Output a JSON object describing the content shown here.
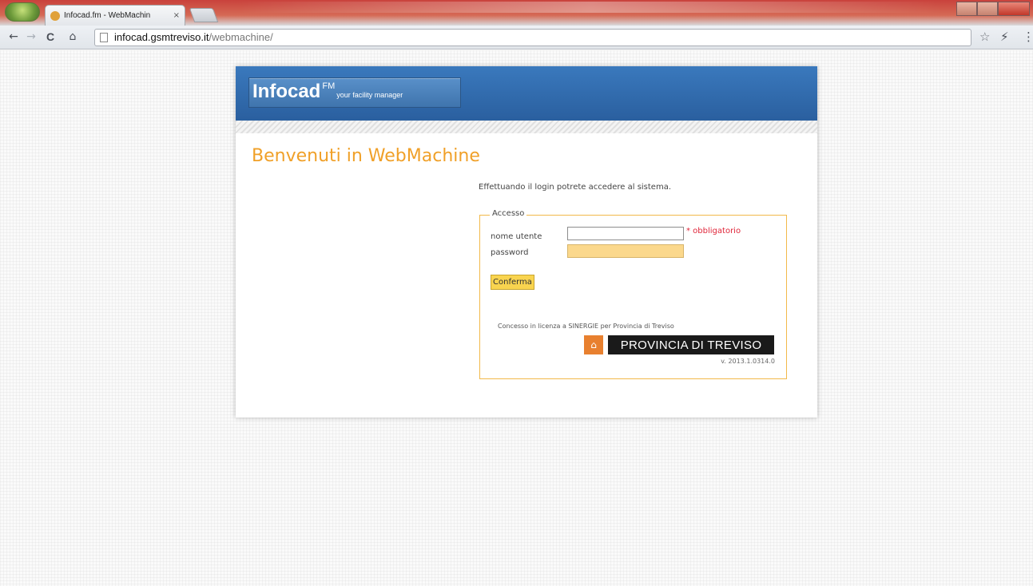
{
  "browser": {
    "tab_title": "Infocad.fm - WebMachin",
    "tab_close": "×",
    "url_host": "infocad.gsmtreviso.it",
    "url_path": "/webmachine/",
    "back": "←",
    "forward": "→",
    "reload": "C",
    "home": "⌂",
    "star": "☆",
    "menu": "⚡"
  },
  "header": {
    "logo_main": "Infocad",
    "logo_sup": "FM",
    "logo_tagline": "your facility manager"
  },
  "main": {
    "title": "Benvenuti in WebMachine",
    "intro": "Effettuando il login potrete accedere al sistema."
  },
  "login": {
    "legend": "Accesso",
    "username_label": "nome utente",
    "password_label": "password",
    "username_value": "",
    "password_value": "",
    "required_note": "* obbligatorio",
    "confirm_label": "Conferma"
  },
  "footer": {
    "license": "Concesso in licenza a SINERGIE per Provincia di Treviso",
    "province_banner": "PROVINCIA DI TREVISO",
    "version": "v. 2013.1.0314.0"
  },
  "icons": [
    "back-icon",
    "forward-icon",
    "reload-icon",
    "home-icon",
    "page-icon",
    "star-icon",
    "menu-icon",
    "province-emblem-icon"
  ],
  "colors": {
    "header_blue": "#2f6aaa",
    "welcome_orange": "#f0a028",
    "fieldset_border": "#f2b94a",
    "required_red": "#e0263a",
    "button_yellow": "#f9d44f"
  }
}
